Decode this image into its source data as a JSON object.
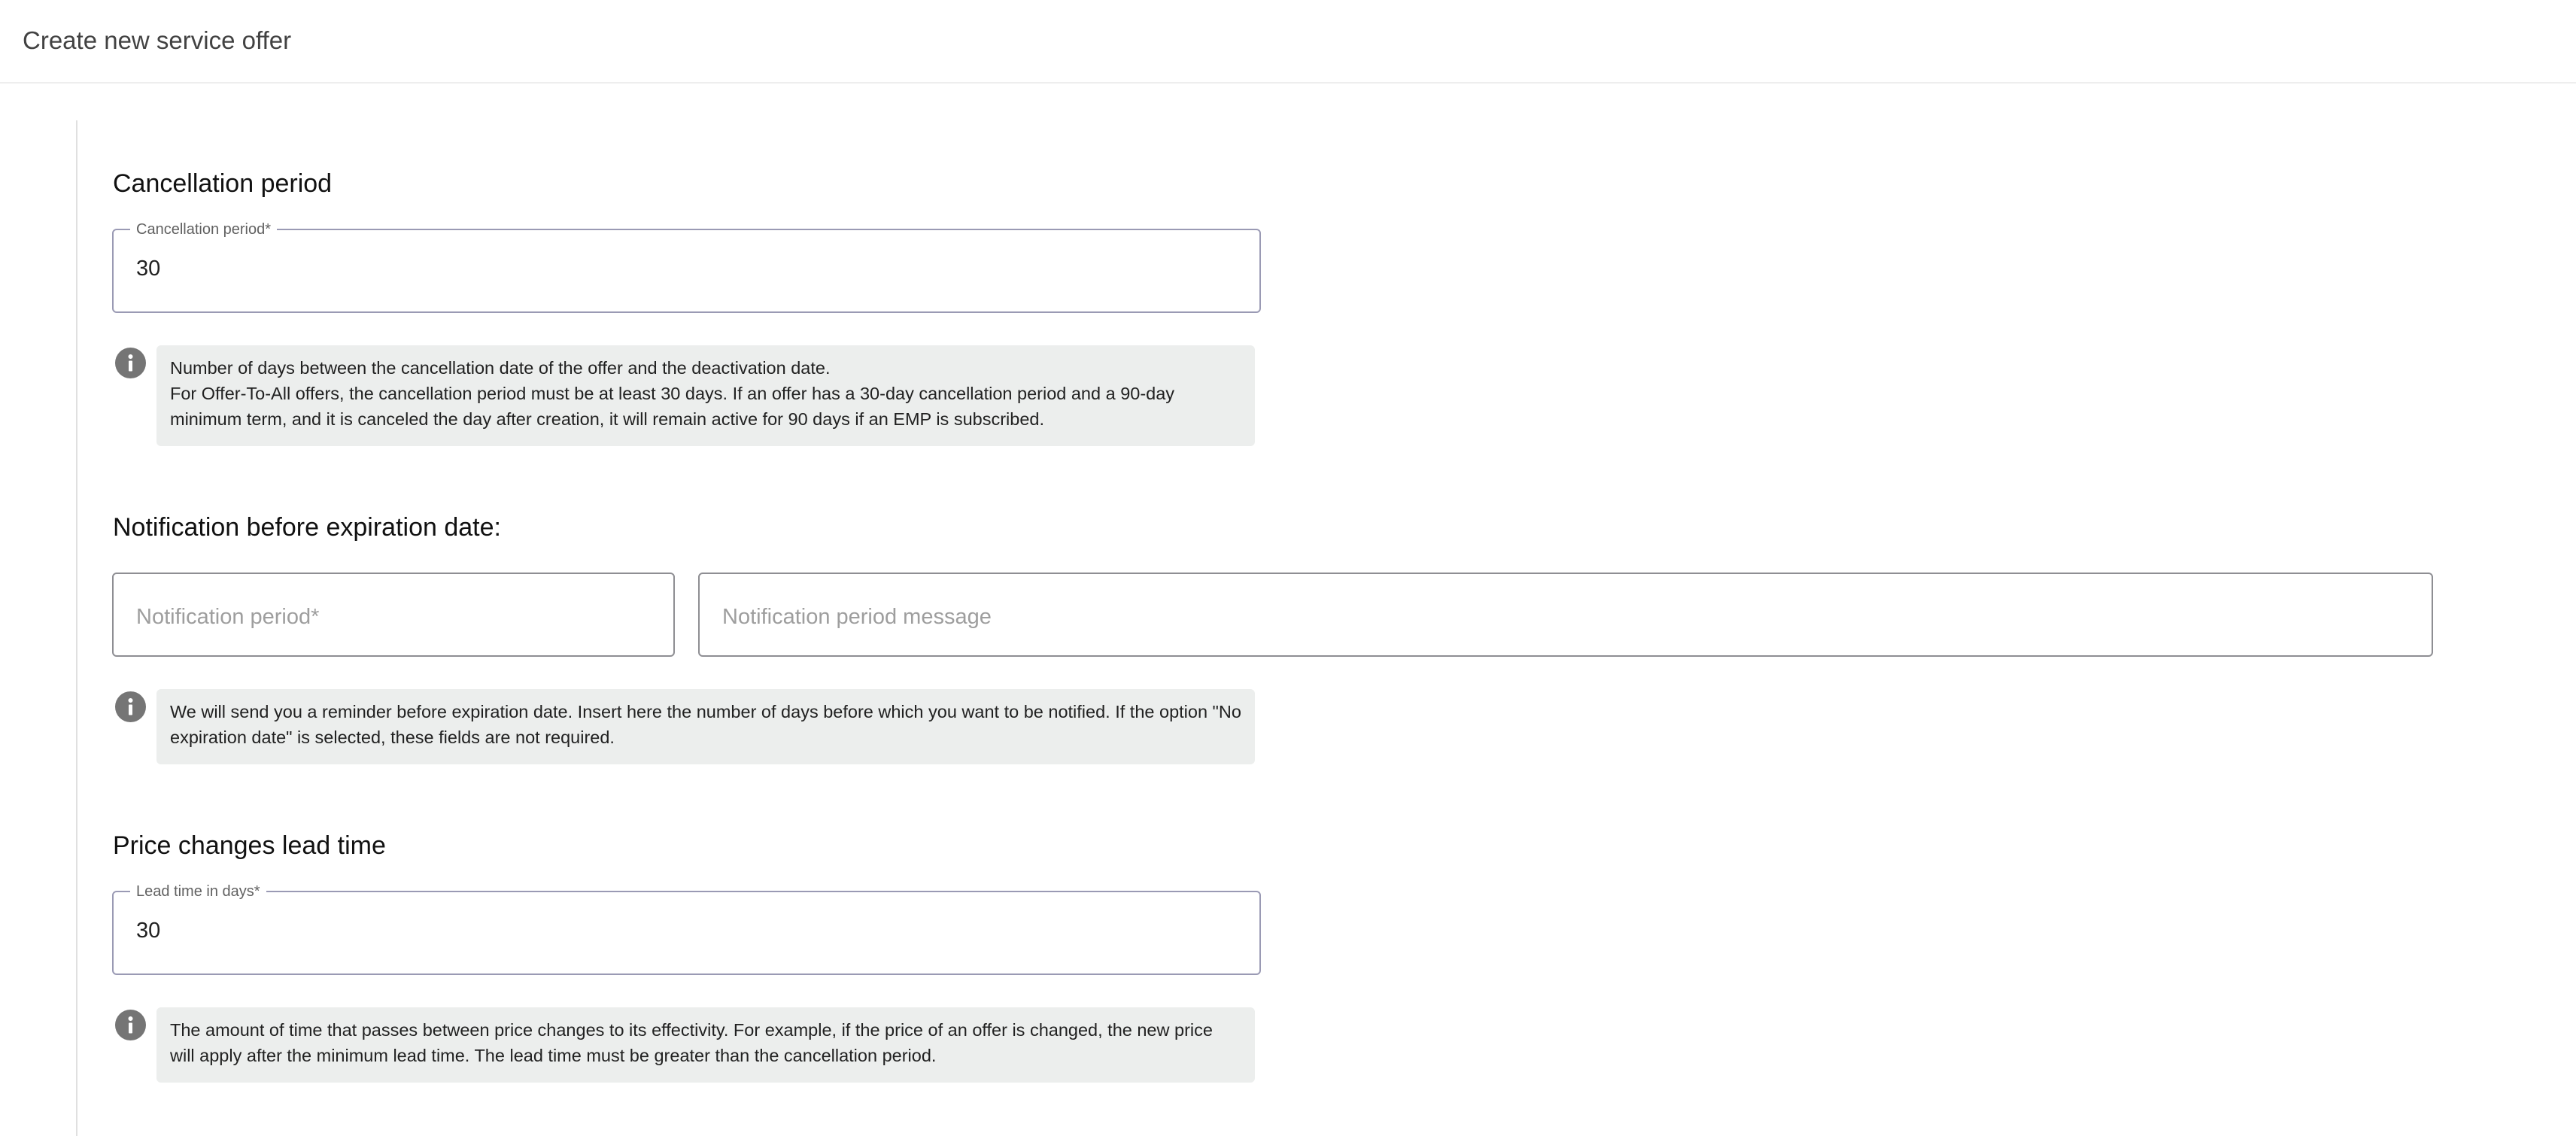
{
  "header": {
    "title": "Create new service offer"
  },
  "cancellation": {
    "section_title": "Cancellation period",
    "field_label": "Cancellation period*",
    "field_value": "30",
    "info_lines": [
      "Number of days between the cancellation date of the offer and the deactivation date.",
      "For Offer-To-All offers, the cancellation period must be at least 30 days. If an offer has a 30-day cancellation period and a 90-day minimum term, and it is canceled the day after creation, it will remain active for 90 days if an EMP is subscribed."
    ]
  },
  "notification": {
    "section_title": "Notification before expiration date:",
    "period_placeholder": "Notification period*",
    "message_placeholder": "Notification period message",
    "info_text": "We will send you a reminder before expiration date. Insert here the number of days before which you want to be notified. If the option \"No expiration date\" is selected, these fields are not required."
  },
  "lead_time": {
    "section_title": "Price changes lead time",
    "field_label": "Lead time in days*",
    "field_value": "30",
    "info_text": "The amount of time that passes between price changes to its effectivity. For example, if the price of an offer is changed, the new price will apply after the minimum lead time. The lead time must be greater than the cancellation period."
  },
  "icons": {
    "info": "info-icon"
  },
  "colors": {
    "field_border": "#9a9ab4",
    "info_background": "#eceeed",
    "info_icon": "#757575"
  }
}
